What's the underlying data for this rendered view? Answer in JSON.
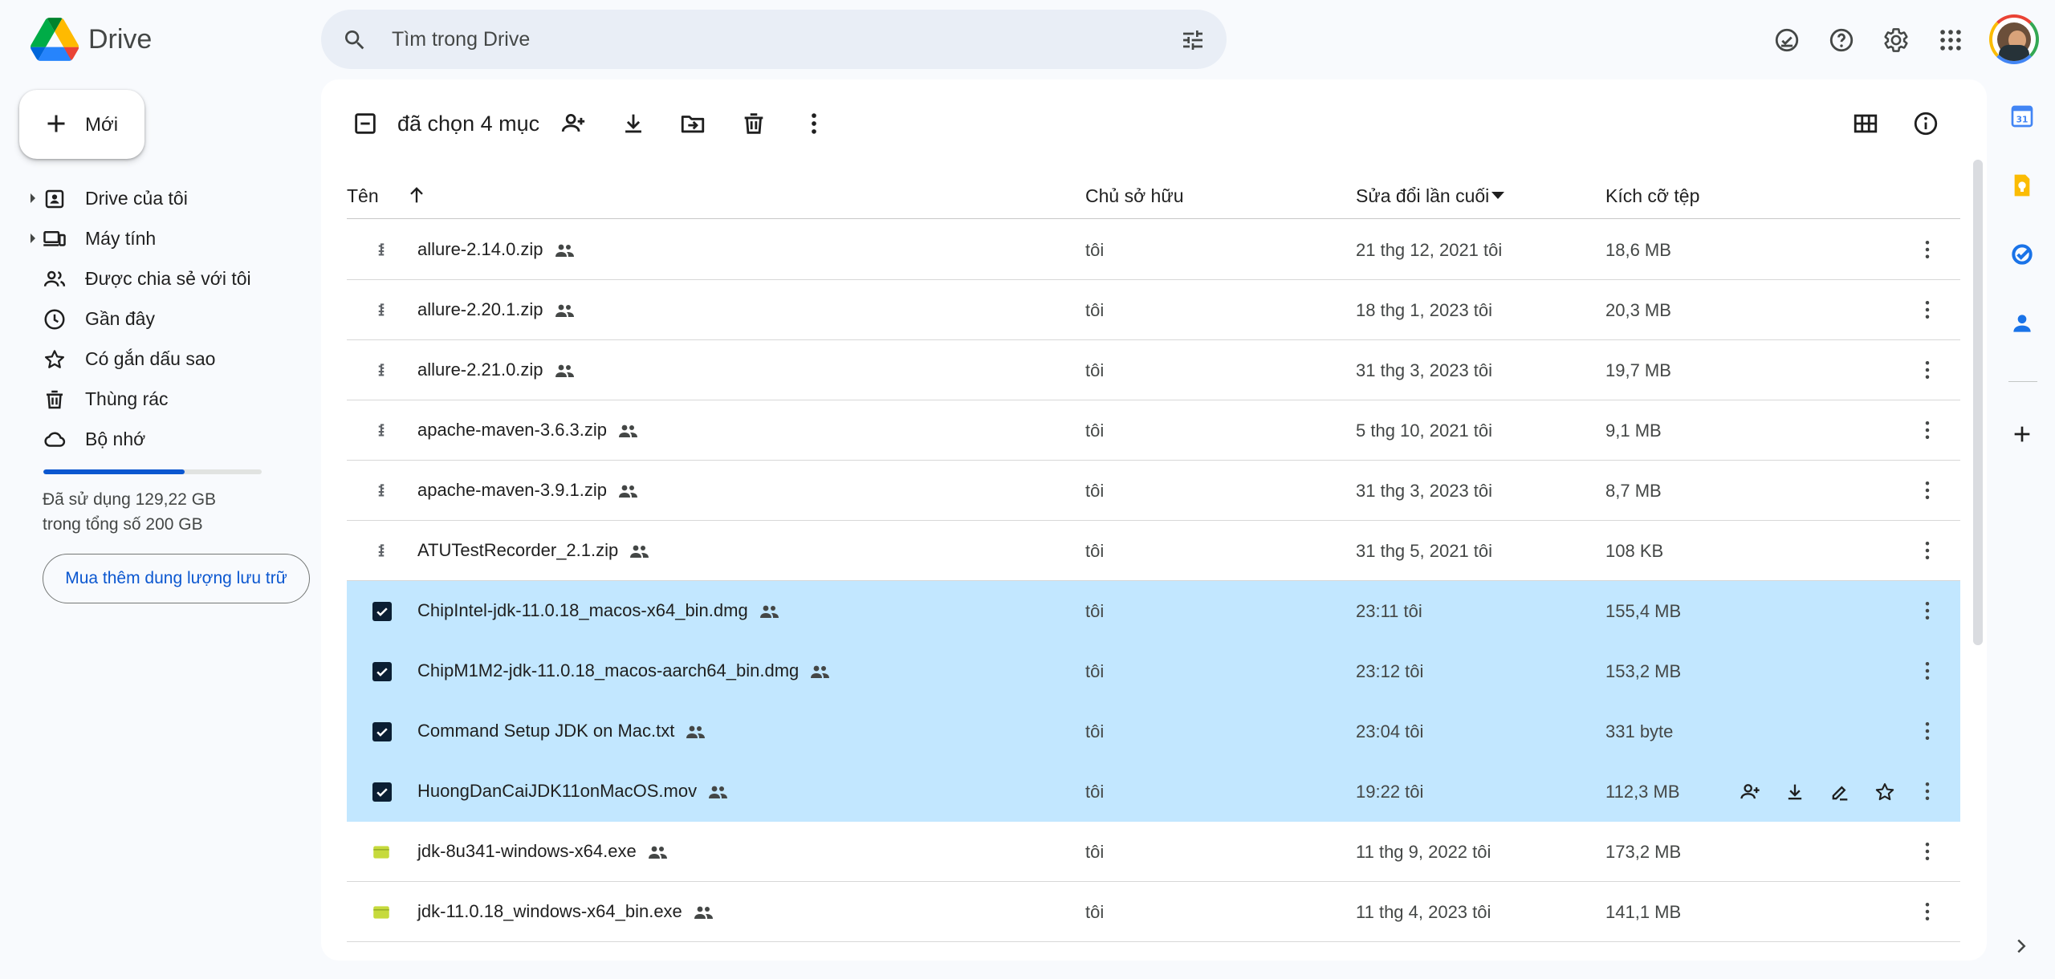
{
  "app": {
    "name": "Drive",
    "search_placeholder": "Tìm trong Drive"
  },
  "sidebar": {
    "new_label": "Mới",
    "items": [
      {
        "label": "Drive của tôi",
        "icon": "my-drive-icon",
        "expandable": true
      },
      {
        "label": "Máy tính",
        "icon": "computers-icon",
        "expandable": true
      },
      {
        "label": "Được chia sẻ với tôi",
        "icon": "shared-icon",
        "expandable": false
      },
      {
        "label": "Gần đây",
        "icon": "clock-icon",
        "expandable": false
      },
      {
        "label": "Có gắn dấu sao",
        "icon": "star-icon",
        "expandable": false
      },
      {
        "label": "Thùng rác",
        "icon": "trash-icon",
        "expandable": false
      },
      {
        "label": "Bộ nhớ",
        "icon": "cloud-icon",
        "expandable": false
      }
    ],
    "storage": {
      "used_fraction": 0.6461,
      "line1": "Đã sử dụng 129,22 GB",
      "line2": "trong tổng số 200 GB",
      "buy_label": "Mua thêm dung lượng lưu trữ"
    }
  },
  "toolbar": {
    "selection_text": "đã chọn 4 mục"
  },
  "table": {
    "headers": {
      "name": "Tên",
      "owner": "Chủ sở hữu",
      "modified": "Sửa đổi lần cuối",
      "size": "Kích cỡ tệp"
    },
    "rows": [
      {
        "name": "allure-2.14.0.zip",
        "owner": "tôi",
        "modified": "21 thg 12, 2021 tôi",
        "size": "18,6 MB",
        "type": "zip",
        "selected": false
      },
      {
        "name": "allure-2.20.1.zip",
        "owner": "tôi",
        "modified": "18 thg 1, 2023 tôi",
        "size": "20,3 MB",
        "type": "zip",
        "selected": false
      },
      {
        "name": "allure-2.21.0.zip",
        "owner": "tôi",
        "modified": "31 thg 3, 2023 tôi",
        "size": "19,7 MB",
        "type": "zip",
        "selected": false
      },
      {
        "name": "apache-maven-3.6.3.zip",
        "owner": "tôi",
        "modified": "5 thg 10, 2021 tôi",
        "size": "9,1 MB",
        "type": "zip",
        "selected": false
      },
      {
        "name": "apache-maven-3.9.1.zip",
        "owner": "tôi",
        "modified": "31 thg 3, 2023 tôi",
        "size": "8,7 MB",
        "type": "zip",
        "selected": false
      },
      {
        "name": "ATUTestRecorder_2.1.zip",
        "owner": "tôi",
        "modified": "31 thg 5, 2021 tôi",
        "size": "108 KB",
        "type": "zip",
        "selected": false
      },
      {
        "name": "ChipIntel-jdk-11.0.18_macos-x64_bin.dmg",
        "owner": "tôi",
        "modified": "23:11 tôi",
        "size": "155,4 MB",
        "type": "dmg",
        "selected": true
      },
      {
        "name": "ChipM1M2-jdk-11.0.18_macos-aarch64_bin.dmg",
        "owner": "tôi",
        "modified": "23:12 tôi",
        "size": "153,2 MB",
        "type": "dmg",
        "selected": true
      },
      {
        "name": "Command Setup JDK on Mac.txt",
        "owner": "tôi",
        "modified": "23:04 tôi",
        "size": "331 byte",
        "type": "txt",
        "selected": true
      },
      {
        "name": "HuongDanCaiJDK11onMacOS.mov",
        "owner": "tôi",
        "modified": "19:22 tôi",
        "size": "112,3 MB",
        "type": "mov",
        "selected": true,
        "hovered": true
      },
      {
        "name": "jdk-8u341-windows-x64.exe",
        "owner": "tôi",
        "modified": "11 thg 9, 2022 tôi",
        "size": "173,2 MB",
        "type": "exe",
        "selected": false
      },
      {
        "name": "jdk-11.0.18_windows-x64_bin.exe",
        "owner": "tôi",
        "modified": "11 thg 4, 2023 tôi",
        "size": "141,1 MB",
        "type": "exe",
        "selected": false
      }
    ]
  },
  "side_apps": {
    "calendar_day": "31"
  },
  "colors": {
    "selected_row": "#c2e7ff",
    "accent": "#0b57d0",
    "exe_icon": "#c6da3c"
  }
}
